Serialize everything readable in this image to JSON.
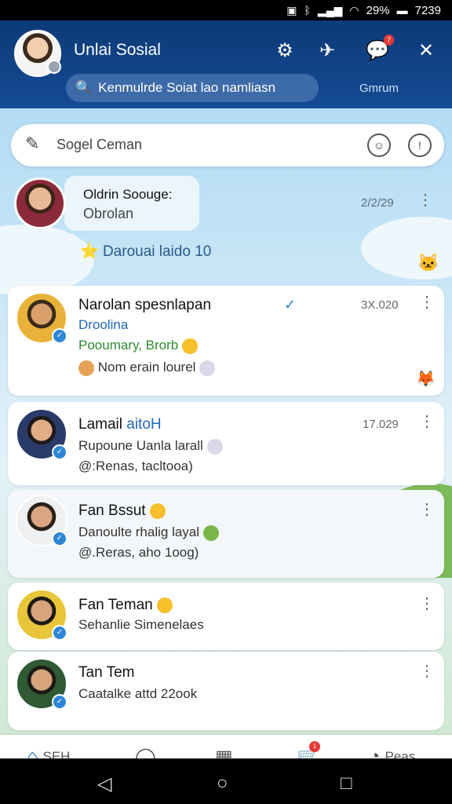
{
  "status_bar": {
    "battery": "29%",
    "time": "7239"
  },
  "header": {
    "title": "Unlai Sosial",
    "search_placeholder": "Kenmulrde Soiat lao namliasn",
    "tab_label": "Gmrum",
    "notification_badge": "7"
  },
  "search": {
    "placeholder": "Sogel Ceman"
  },
  "story": {
    "title": "Oldrin Soouge:",
    "subtitle": "Obrolan",
    "time": "2/2/29",
    "caption": "Darouai laido 10"
  },
  "chats": [
    {
      "name": "Narolan spesnlapan",
      "time": "3X.020",
      "line1": "Droolina",
      "line2": "Pooumary, Brorb",
      "line3": "Nom erain lourel",
      "read": true
    },
    {
      "name": "Lamail",
      "name_tag": "aitoH",
      "time": "17.029",
      "line1": "Rupoune Uanla larall",
      "line2": "@:Renas, tacltooa)"
    },
    {
      "name": "Fan Bssut",
      "time": "",
      "line1": "Danoulte rhalig layal",
      "line2": "@.Reras, aho 1oog)"
    },
    {
      "name": "Fan Teman",
      "time": "",
      "line1": "Sehanlie Simenelaes"
    },
    {
      "name": "Tan Tem",
      "time": "",
      "line1": "Caatalke attd 22ook"
    }
  ],
  "bottom_nav": [
    {
      "label": "SEH",
      "icon": "home-icon"
    },
    {
      "label": "",
      "icon": "chat-bubble-icon"
    },
    {
      "label": "",
      "icon": "grid-icon"
    },
    {
      "label": "",
      "icon": "cart-icon",
      "badge": "1"
    },
    {
      "label": "Peas",
      "icon": "clock-icon"
    }
  ],
  "colors": {
    "header": "#144b93",
    "accent": "#2f86d6",
    "badge": "#e53935"
  }
}
